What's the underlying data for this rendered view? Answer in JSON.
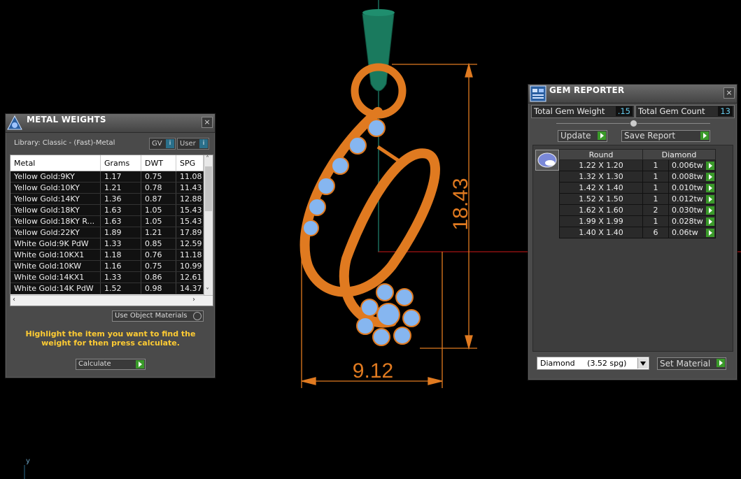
{
  "viewport": {
    "dimension_width": "9.12",
    "dimension_height": "18.43",
    "axis_label": "y"
  },
  "metal_weights": {
    "title": "METAL WEIGHTS",
    "library": "Library: Classic - (Fast)-Metal",
    "gv_label": "GV",
    "user_label": "User",
    "columns": [
      "Metal",
      "Grams",
      "DWT",
      "SPG"
    ],
    "rows": [
      [
        "Yellow Gold:9KY",
        "1.17",
        "0.75",
        "11.08"
      ],
      [
        "Yellow Gold:10KY",
        "1.21",
        "0.78",
        "11.43"
      ],
      [
        "Yellow Gold:14KY",
        "1.36",
        "0.87",
        "12.88"
      ],
      [
        "Yellow Gold:18KY",
        "1.63",
        "1.05",
        "15.43"
      ],
      [
        "Yellow Gold:18KY R...",
        "1.63",
        "1.05",
        "15.43"
      ],
      [
        "Yellow Gold:22KY",
        "1.89",
        "1.21",
        "17.89"
      ],
      [
        "White Gold:9K PdW",
        "1.33",
        "0.85",
        "12.59"
      ],
      [
        "White Gold:10KX1",
        "1.18",
        "0.76",
        "11.18"
      ],
      [
        "White Gold:10KW",
        "1.16",
        "0.75",
        "10.99"
      ],
      [
        "White Gold:14KX1",
        "1.33",
        "0.86",
        "12.61"
      ],
      [
        "White Gold:14K PdW",
        "1.52",
        "0.98",
        "14.37"
      ]
    ],
    "use_object_materials": "Use Object Materials",
    "hint": "Highlight the item you want to find the weight for then press calculate.",
    "calculate": "Calculate"
  },
  "gem_reporter": {
    "title": "GEM REPORTER",
    "total_gem_weight_label": "Total Gem Weight",
    "total_gem_weight": ".15",
    "total_gem_count_label": "Total Gem Count",
    "total_gem_count": "13",
    "update": "Update",
    "save_report": "Save Report",
    "header_shape": "Round",
    "header_material": "Diamond",
    "rows": [
      [
        "1.22 X 1.20",
        "1",
        "0.006tw"
      ],
      [
        "1.32 X 1.30",
        "1",
        "0.008tw"
      ],
      [
        "1.42 X 1.40",
        "1",
        "0.010tw"
      ],
      [
        "1.52 X 1.50",
        "1",
        "0.012tw"
      ],
      [
        "1.62 X 1.60",
        "2",
        "0.030tw"
      ],
      [
        "1.99 X 1.99",
        "1",
        "0.028tw"
      ],
      [
        "1.40 X 1.40",
        "6",
        "0.06tw"
      ]
    ],
    "material_select": "Diamond     (3.52 spg)",
    "set_material": "Set Material"
  }
}
